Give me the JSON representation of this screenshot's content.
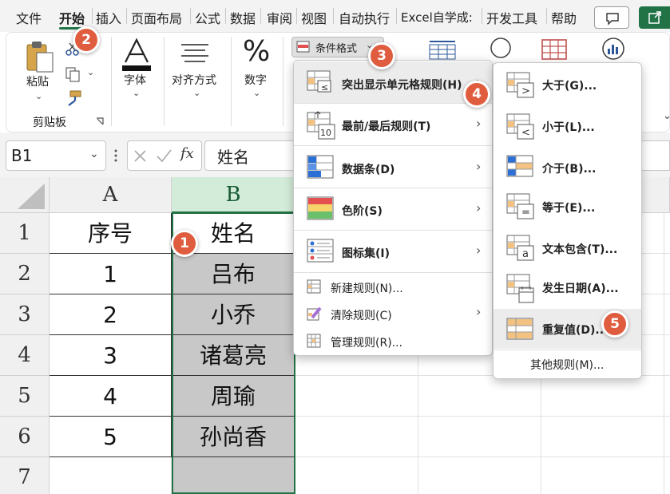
{
  "menubar": {
    "tabs": [
      "文件",
      "开始",
      "插入",
      "页面布局",
      "公式",
      "数据",
      "审阅",
      "视图",
      "自动执行",
      "Excel自学成:",
      "开发工具",
      "帮助"
    ],
    "active_tab": "开始"
  },
  "ribbon": {
    "clipboard_paste": "粘贴",
    "clipboard_group": "剪贴板",
    "font": "字体",
    "alignment": "对齐方式",
    "number": "数字",
    "conditional_formatting": "条件格式"
  },
  "formula_bar": {
    "name_box": "B1",
    "formula": "姓名"
  },
  "sheet": {
    "columns": [
      "A",
      "B"
    ],
    "rows": [
      "1",
      "2",
      "3",
      "4",
      "5",
      "6",
      "7"
    ],
    "cells": [
      [
        "序号",
        "姓名"
      ],
      [
        "1",
        "吕布"
      ],
      [
        "2",
        "小乔"
      ],
      [
        "3",
        "诸葛亮"
      ],
      [
        "4",
        "周瑜"
      ],
      [
        "5",
        "孙尚香"
      ],
      [
        "",
        ""
      ]
    ]
  },
  "cf_menu": {
    "highlight_rules": "突出显示单元格规则(H)",
    "top_bottom_rules": "最前/最后规则(T)",
    "data_bars": "数据条(D)",
    "color_scales": "色阶(S)",
    "icon_sets": "图标集(I)",
    "new_rule": "新建规则(N)...",
    "clear_rules": "清除规则(C)",
    "manage_rules": "管理规则(R)..."
  },
  "submenu": {
    "greater_than": "大于(G)...",
    "less_than": "小于(L)...",
    "between": "介于(B)...",
    "equal_to": "等于(E)...",
    "text_contains": "文本包含(T)...",
    "date_occurring": "发生日期(A)...",
    "duplicate_values": "重复值(D)...",
    "more_rules": "其他规则(M)..."
  },
  "badges": [
    "1",
    "2",
    "3",
    "4",
    "5"
  ],
  "icons": {
    "top_bottom_badge": "10",
    "greater_sign": ">",
    "less_sign": "<",
    "equal_sign": "=",
    "text_sign": "a",
    "fx": "fx"
  },
  "colors": {
    "accent_green": "#217346",
    "badge_red": "#e05c3e",
    "selection_fill": "#c8c8c8"
  }
}
